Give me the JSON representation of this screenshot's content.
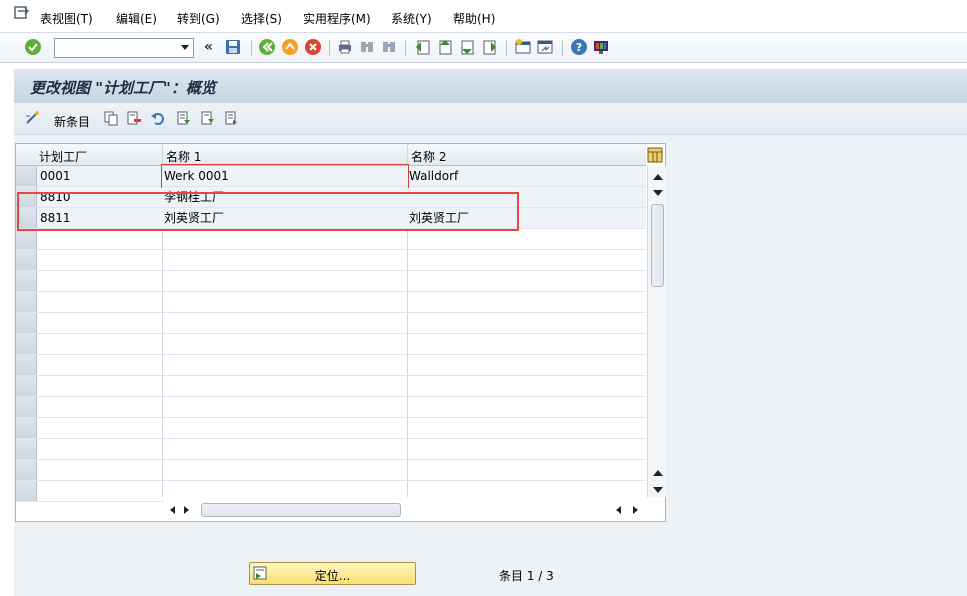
{
  "menu": {
    "items": [
      "表视图(T)",
      "编辑(E)",
      "转到(G)",
      "选择(S)",
      "实用程序(M)",
      "系统(Y)",
      "帮助(H)"
    ]
  },
  "toolbar": {
    "command_value": "",
    "history_label": "«"
  },
  "title": "更改视图 \"计划工厂\"：概览",
  "app_toolbar": {
    "new_entries_label": "新条目"
  },
  "table": {
    "headers": [
      "计划工厂",
      "名称 1",
      "名称 2"
    ],
    "rows": [
      [
        "0001",
        "Werk 0001",
        "Walldorf"
      ],
      [
        "8810",
        "李钢桂工厂",
        ""
      ],
      [
        "8811",
        "刘英贤工厂",
        "刘英贤工厂"
      ]
    ],
    "empty_rows": 13
  },
  "footer": {
    "position_button_label": "定位...",
    "entry_counter": "条目 1 / 3"
  },
  "colors": {
    "highlight": "#e84545",
    "accent_button": "#f7df72"
  }
}
